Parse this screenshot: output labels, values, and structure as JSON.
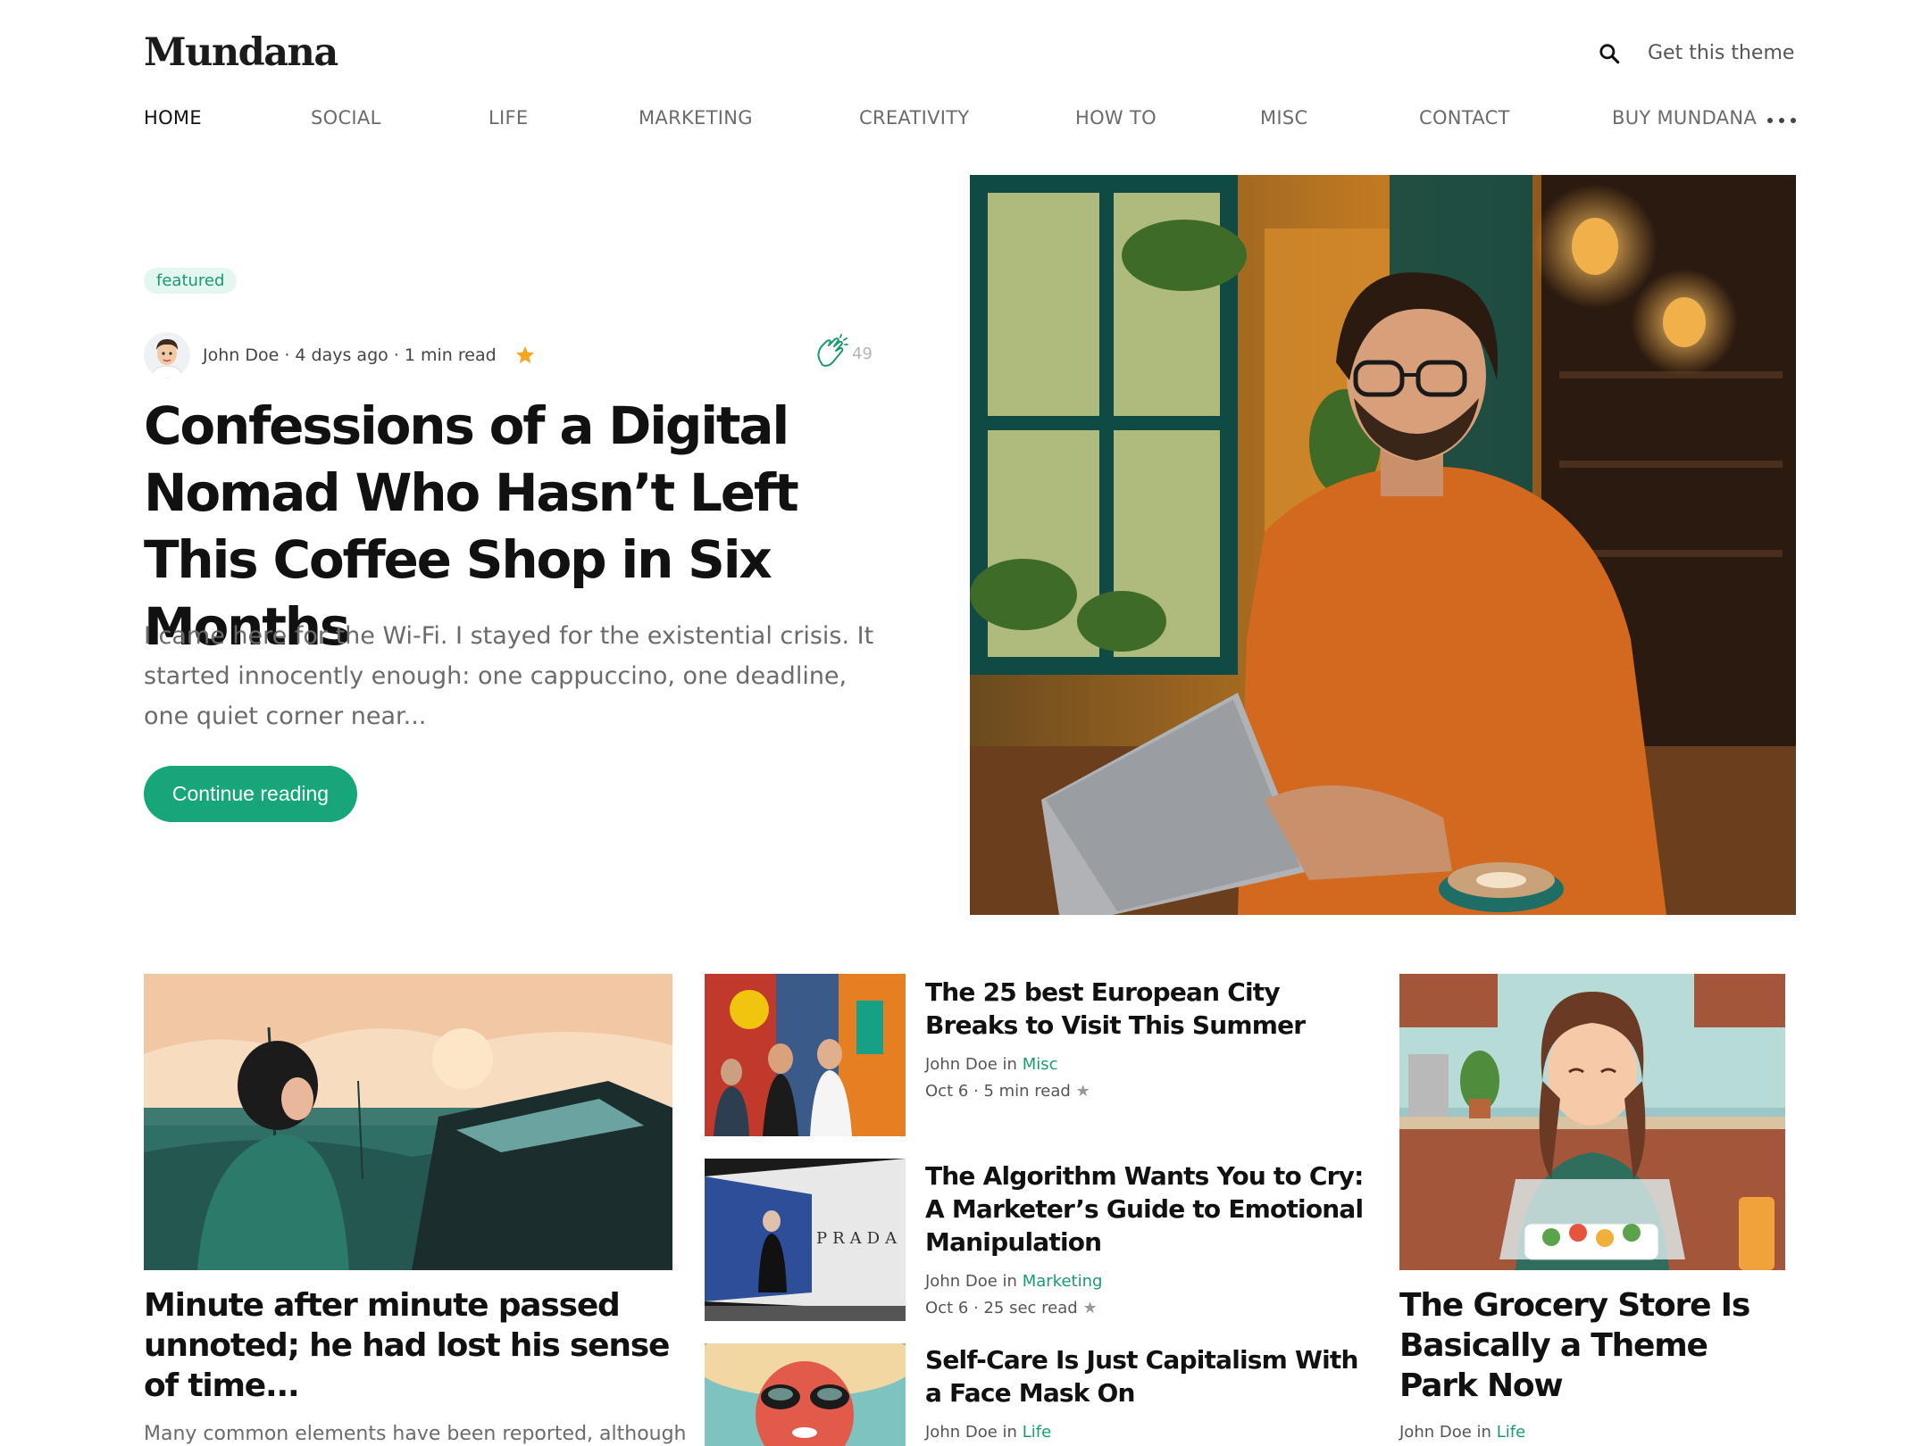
{
  "site": {
    "logo": "Mundana",
    "get_theme_label": "Get this theme"
  },
  "nav": {
    "items": [
      {
        "label": "HOME",
        "active": true
      },
      {
        "label": "SOCIAL"
      },
      {
        "label": "LIFE"
      },
      {
        "label": "MARKETING"
      },
      {
        "label": "CREATIVITY"
      },
      {
        "label": "HOW TO"
      },
      {
        "label": "MISC"
      },
      {
        "label": "CONTACT"
      },
      {
        "label": "BUY MUNDANA"
      }
    ],
    "more_icon": "more-dots-icon"
  },
  "featured": {
    "badge": "featured",
    "meta": "John Doe · 4 days ago · 1 min read",
    "claps": "49",
    "title": "Confessions of a Digital Nomad Who Hasn’t Left This Coffee Shop in Six Months",
    "excerpt": "I came here for the Wi-Fi. I stayed for the existential crisis. It started innocently enough: one cappuccino, one deadline, one quiet corner near...",
    "cta": "Continue reading",
    "accent_color": "#17a57a"
  },
  "posts": {
    "left": {
      "title": "Minute after minute passed unnoted; he had lost his sense of time...",
      "excerpt": "Many common elements have been reported, although"
    },
    "middle": [
      {
        "title": "The 25 best European City Breaks to Visit This Summer",
        "author": "John Doe",
        "in": "in",
        "category": "Misc",
        "date_read": "Oct 6 · 5 min read"
      },
      {
        "title": "The Algorithm Wants You to Cry: A Marketer’s Guide to Emotional Manipulation",
        "author": "John Doe",
        "in": "in",
        "category": "Marketing",
        "date_read": "Oct 6 · 25 sec read"
      },
      {
        "title": "Self-Care Is Just Capitalism With a Face Mask On",
        "author": "John Doe",
        "in": "in",
        "category": "Life"
      }
    ],
    "right": {
      "title": "The Grocery Store Is Basically a Theme Park Now",
      "author": "John Doe",
      "in": "in",
      "category": "Life"
    },
    "star_glyph": "★"
  }
}
